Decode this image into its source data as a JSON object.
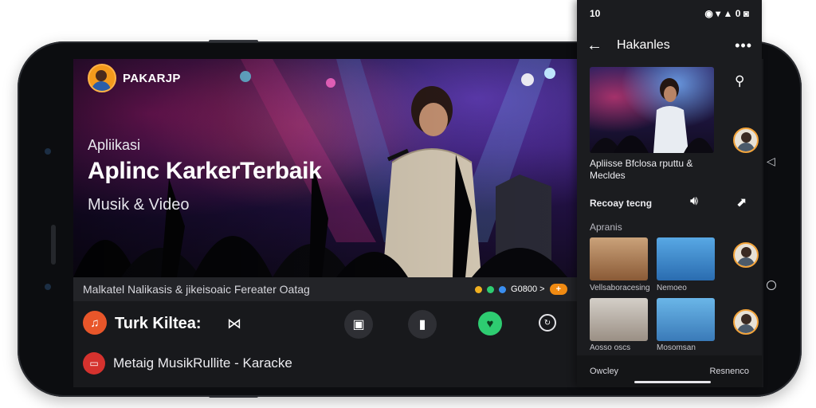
{
  "brand": {
    "name": "PAKARJP"
  },
  "hero": {
    "small": "Apliikasi",
    "title": "Aplinc KarkerTerbaik",
    "subtitle": "Musik & Video"
  },
  "strip": {
    "text": "Malkatel Nalikasis & jikeisoaic Fereater Oatag",
    "count": "G0800 >",
    "pill": "+"
  },
  "player": {
    "track_title": "Turk Kiltea:",
    "footer_text": "Metaig MusikRullite - Karacke"
  },
  "panel": {
    "status_time": "10",
    "status_icons": "◉ ▾ ▲ 0 ◙",
    "title": "Hakanles",
    "video_title": "Apliisse Bfclosa rputtu & Mecldes",
    "row_label": "Recoay tecng",
    "section_label": "Apranis",
    "grid_captions": [
      "Vellsaboracesing",
      "Nemoeo",
      "Aosso oscs",
      "Mosomsan"
    ],
    "bottom_left": "Owcley",
    "bottom_right": "Resnenco"
  },
  "icons": {
    "bowtie": "bowtie-icon",
    "photo": "photo-icon",
    "book": "book-icon",
    "heart": "heart-icon",
    "loop": "loop-icon"
  },
  "colors": {
    "accent_orange": "#f08a12",
    "accent_green": "#2ecc71",
    "accent_red": "#d5322e"
  }
}
